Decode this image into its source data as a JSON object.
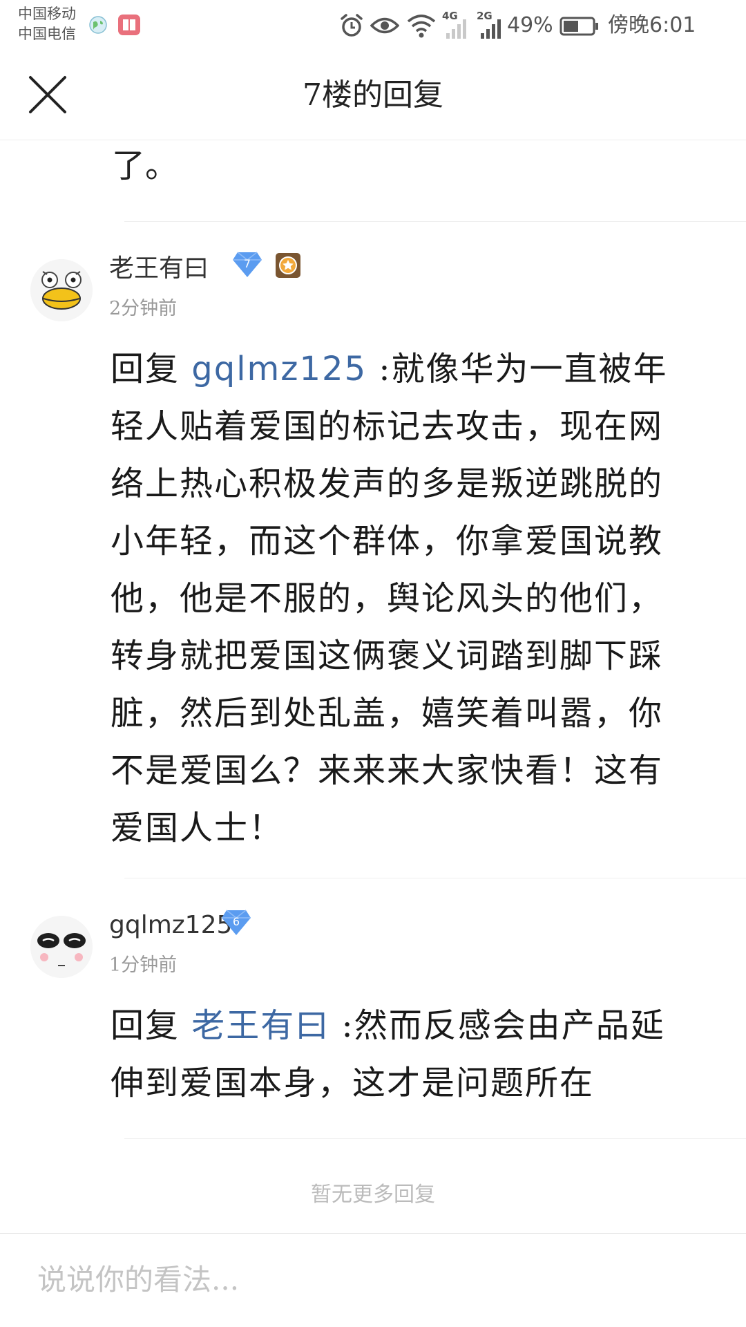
{
  "status_bar": {
    "carrier_1": "中国移动",
    "carrier_2": "中国电信",
    "network_1": "4G",
    "network_2": "2G",
    "battery_percent": "49%",
    "time": "傍晚6:01"
  },
  "header": {
    "title": "7楼的回复"
  },
  "previous_text_tail": "了。",
  "replies": [
    {
      "username": "老王有曰",
      "level": "7",
      "timestamp": "2分钟前",
      "reply_prefix": "回复 ",
      "mention": "gqlmz125",
      "body": " :就像华为一直被年轻人贴着爱国的标记去攻击，现在网络上热心积极发声的多是叛逆跳脱的小年轻，而这个群体，你拿爱国说教他，他是不服的，舆论风头的他们，转身就把爱国这俩褒义词踏到脚下踩脏，然后到处乱盖，嬉笑着叫嚣，你不是爱国么？来来来大家快看！这有爱国人士！"
    },
    {
      "username": "gqlmz125",
      "level": "6",
      "timestamp": "1分钟前",
      "reply_prefix": "回复 ",
      "mention": "老王有曰",
      "body": " :然而反感会由产品延伸到爱国本身，这才是问题所在"
    }
  ],
  "no_more_text": "暂无更多回复",
  "input": {
    "placeholder": "说说你的看法..."
  },
  "colors": {
    "mention": "#3d68a3",
    "level_badge": "#5b9cf0",
    "muted": "#999999"
  },
  "icons": [
    "earth-icon",
    "app-icon",
    "alarm-icon",
    "eye-icon",
    "wifi-icon",
    "signal-icon",
    "battery-icon",
    "close-icon",
    "level-badge-icon",
    "medal-icon"
  ]
}
